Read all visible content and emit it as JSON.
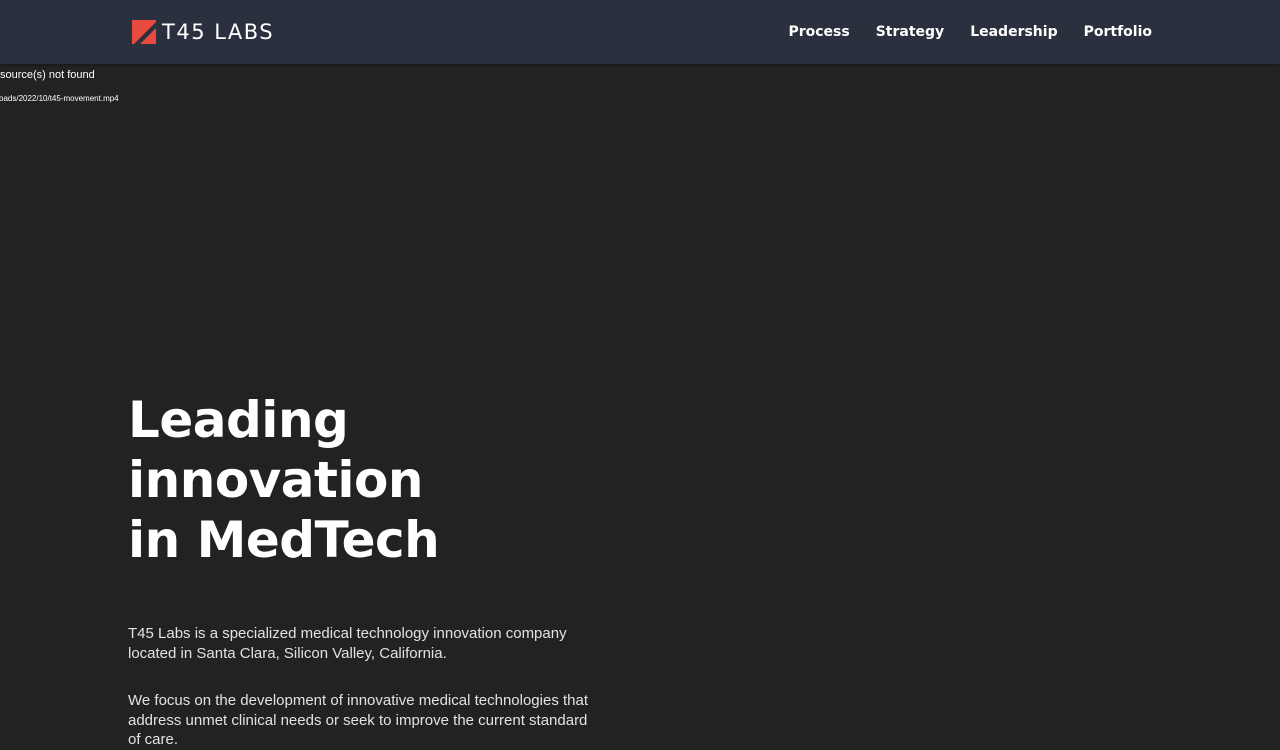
{
  "header": {
    "logo_text": "T45 LABS",
    "logo_accent_color": "#e94a3f",
    "background_color": "#2a303d",
    "nav": [
      {
        "label": "Process"
      },
      {
        "label": "Strategy"
      },
      {
        "label": "Leadership"
      },
      {
        "label": "Portfolio"
      }
    ]
  },
  "video_error": {
    "message": "source(s) not found",
    "path": "oads/2022/10/t45-movement.mp4"
  },
  "hero": {
    "title_line1": "Leading innovation",
    "title_line2": "in MedTech",
    "paragraph1": "T45 Labs is a specialized medical technology innovation company located in Santa Clara, Silicon Valley, California.",
    "paragraph2": "We focus on the development of innovative medical technologies that address unmet clinical needs or seek to improve the current standard of care."
  },
  "page": {
    "background_color": "#222222"
  }
}
